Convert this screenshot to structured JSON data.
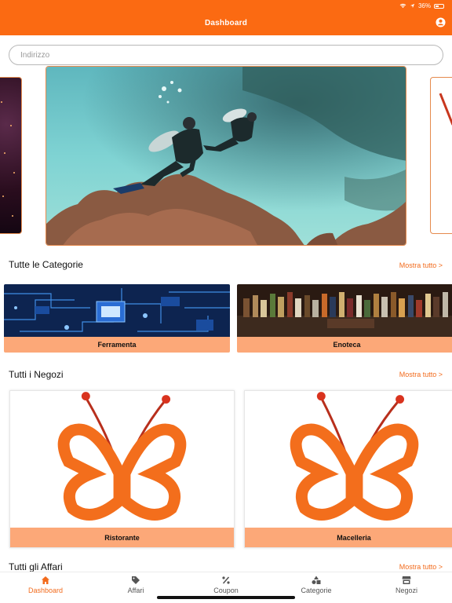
{
  "status_bar": {
    "battery": "36%"
  },
  "header": {
    "title": "Dashboard"
  },
  "address": {
    "placeholder": "Indirizzo",
    "value": ""
  },
  "sections": {
    "categories": {
      "title": "Tutte le Categorie",
      "show_all": "Mostra tutto >"
    },
    "stores": {
      "title": "Tutti i Negozi",
      "show_all": "Mostra tutto >"
    },
    "deals": {
      "title": "Tutti gli Affari",
      "show_all": "Mostra tutto >"
    }
  },
  "categories": [
    {
      "label": "Ferramenta"
    },
    {
      "label": "Enoteca"
    }
  ],
  "stores": [
    {
      "label": "Ristorante"
    },
    {
      "label": "Macelleria"
    }
  ],
  "nav": [
    {
      "label": "Dashboard",
      "icon": "home-icon",
      "active": true
    },
    {
      "label": "Affari",
      "icon": "tag-icon",
      "active": false
    },
    {
      "label": "Coupon",
      "icon": "percent-icon",
      "active": false
    },
    {
      "label": "Categorie",
      "icon": "shapes-icon",
      "active": false
    },
    {
      "label": "Negozi",
      "icon": "store-icon",
      "active": false
    }
  ],
  "colors": {
    "accent": "#fb6a12",
    "label_bg": "#fca878",
    "link": "#f26b1d"
  }
}
